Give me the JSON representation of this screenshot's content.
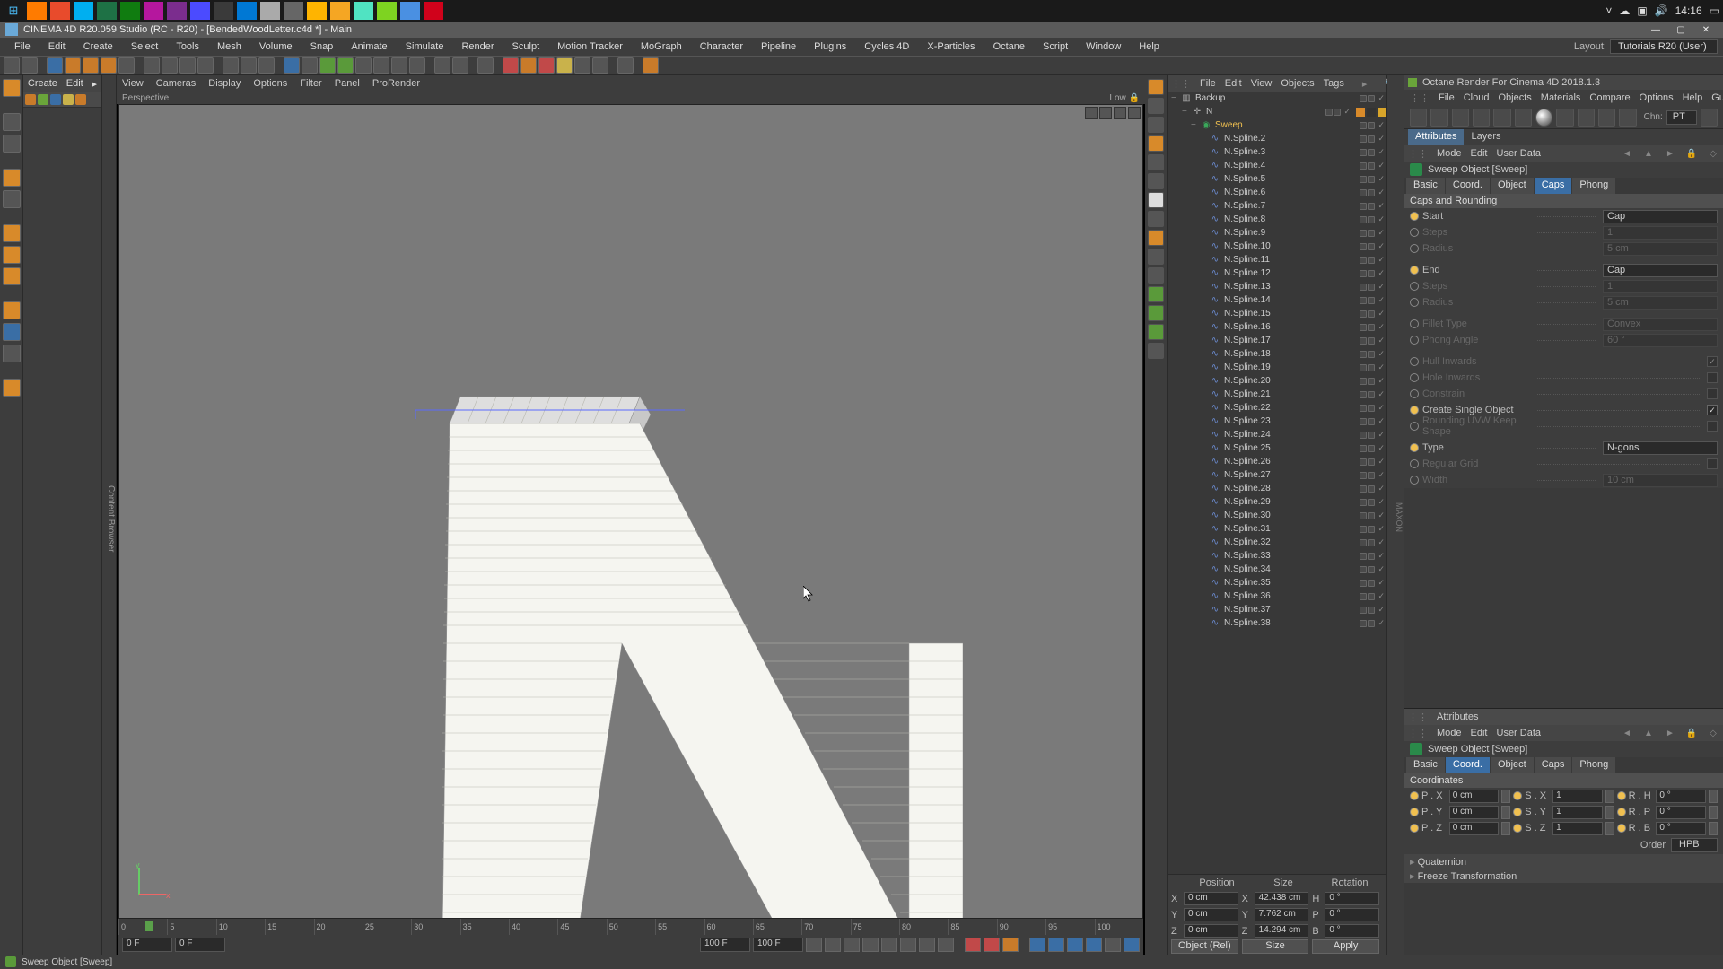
{
  "taskbar": {
    "time": "14:16",
    "icons": [
      "win",
      "ff",
      "ch",
      "sk",
      "xb",
      "a",
      "b",
      "c",
      "d",
      "e",
      "f",
      "g",
      "h",
      "j",
      "k",
      "l",
      "m",
      "n",
      "o"
    ],
    "tray": [
      "▲",
      "☁",
      "▣",
      "🔊"
    ]
  },
  "titlebar": {
    "title": "CINEMA 4D R20.059 Studio (RC - R20) - [BendedWoodLetter.c4d *] - Main"
  },
  "mainmenu": {
    "items": [
      "File",
      "Edit",
      "Create",
      "Select",
      "Tools",
      "Mesh",
      "Volume",
      "Snap",
      "Animate",
      "Simulate",
      "Render",
      "Sculpt",
      "Motion Tracker",
      "MoGraph",
      "Character",
      "Pipeline",
      "Plugins",
      "Cycles 4D",
      "X-Particles",
      "Octane",
      "Script",
      "Window",
      "Help"
    ],
    "layout_label": "Layout:",
    "layout_value": "Tutorials R20 (User)"
  },
  "palette": {
    "create": "Create",
    "edit": "Edit"
  },
  "content_browser_tab": "Content Browser",
  "viewport": {
    "menu": [
      "View",
      "Cameras",
      "Display",
      "Options",
      "Filter",
      "Panel",
      "ProRender"
    ],
    "label_left": "Perspective",
    "label_right": "Low"
  },
  "timeline": {
    "marks": [
      "0",
      "5",
      "10",
      "15",
      "20",
      "25",
      "30",
      "35",
      "40",
      "45",
      "50",
      "55",
      "60",
      "65",
      "70",
      "75",
      "80",
      "85",
      "90",
      "95",
      "100"
    ],
    "frame_start": "0 F",
    "frame_cur": "0 F",
    "frame_end1": "100 F",
    "frame_end2": "100 F"
  },
  "hierarchy": {
    "menu": [
      "File",
      "Edit",
      "View",
      "Objects",
      "Tags"
    ],
    "rows": [
      {
        "icon": "layer",
        "label": "Backup",
        "indent": 0,
        "toggle": "−"
      },
      {
        "icon": "axis",
        "label": "N",
        "indent": 1,
        "toggle": "−",
        "tags": true
      },
      {
        "icon": "sweep",
        "label": "Sweep",
        "indent": 2,
        "toggle": "−",
        "sel": true
      },
      {
        "icon": "spline",
        "label": "N.Spline.2",
        "indent": 3
      },
      {
        "icon": "spline",
        "label": "N.Spline.3",
        "indent": 3
      },
      {
        "icon": "spline",
        "label": "N.Spline.4",
        "indent": 3
      },
      {
        "icon": "spline",
        "label": "N.Spline.5",
        "indent": 3
      },
      {
        "icon": "spline",
        "label": "N.Spline.6",
        "indent": 3
      },
      {
        "icon": "spline",
        "label": "N.Spline.7",
        "indent": 3
      },
      {
        "icon": "spline",
        "label": "N.Spline.8",
        "indent": 3
      },
      {
        "icon": "spline",
        "label": "N.Spline.9",
        "indent": 3
      },
      {
        "icon": "spline",
        "label": "N.Spline.10",
        "indent": 3
      },
      {
        "icon": "spline",
        "label": "N.Spline.11",
        "indent": 3
      },
      {
        "icon": "spline",
        "label": "N.Spline.12",
        "indent": 3
      },
      {
        "icon": "spline",
        "label": "N.Spline.13",
        "indent": 3
      },
      {
        "icon": "spline",
        "label": "N.Spline.14",
        "indent": 3
      },
      {
        "icon": "spline",
        "label": "N.Spline.15",
        "indent": 3
      },
      {
        "icon": "spline",
        "label": "N.Spline.16",
        "indent": 3
      },
      {
        "icon": "spline",
        "label": "N.Spline.17",
        "indent": 3
      },
      {
        "icon": "spline",
        "label": "N.Spline.18",
        "indent": 3
      },
      {
        "icon": "spline",
        "label": "N.Spline.19",
        "indent": 3
      },
      {
        "icon": "spline",
        "label": "N.Spline.20",
        "indent": 3
      },
      {
        "icon": "spline",
        "label": "N.Spline.21",
        "indent": 3
      },
      {
        "icon": "spline",
        "label": "N.Spline.22",
        "indent": 3
      },
      {
        "icon": "spline",
        "label": "N.Spline.23",
        "indent": 3
      },
      {
        "icon": "spline",
        "label": "N.Spline.24",
        "indent": 3
      },
      {
        "icon": "spline",
        "label": "N.Spline.25",
        "indent": 3
      },
      {
        "icon": "spline",
        "label": "N.Spline.26",
        "indent": 3
      },
      {
        "icon": "spline",
        "label": "N.Spline.27",
        "indent": 3
      },
      {
        "icon": "spline",
        "label": "N.Spline.28",
        "indent": 3
      },
      {
        "icon": "spline",
        "label": "N.Spline.29",
        "indent": 3
      },
      {
        "icon": "spline",
        "label": "N.Spline.30",
        "indent": 3
      },
      {
        "icon": "spline",
        "label": "N.Spline.31",
        "indent": 3
      },
      {
        "icon": "spline",
        "label": "N.Spline.32",
        "indent": 3
      },
      {
        "icon": "spline",
        "label": "N.Spline.33",
        "indent": 3
      },
      {
        "icon": "spline",
        "label": "N.Spline.34",
        "indent": 3
      },
      {
        "icon": "spline",
        "label": "N.Spline.35",
        "indent": 3
      },
      {
        "icon": "spline",
        "label": "N.Spline.36",
        "indent": 3
      },
      {
        "icon": "spline",
        "label": "N.Spline.37",
        "indent": 3
      },
      {
        "icon": "spline",
        "label": "N.Spline.38",
        "indent": 3
      }
    ]
  },
  "coords": {
    "heads": [
      "Position",
      "Size",
      "Rotation"
    ],
    "rows": [
      {
        "axis": "X",
        "pos": "0 cm",
        "size": "42.438 cm",
        "rot": "0 °"
      },
      {
        "axis": "Y",
        "pos": "0 cm",
        "size": "7.762 cm",
        "rot": "0 °"
      },
      {
        "axis": "Z",
        "pos": "0 cm",
        "size": "14.294 cm",
        "rot": "0 °"
      }
    ],
    "mode1": "Object (Rel)",
    "mode2": "Size",
    "apply": "Apply"
  },
  "octane": {
    "title": "Octane Render For Cinema 4D 2018.1.3",
    "menu": [
      "File",
      "Cloud",
      "Objects",
      "Materials",
      "Compare",
      "Options",
      "Help",
      "Gui"
    ],
    "chn_label": "Chn:",
    "chn_value": "PT"
  },
  "attr1": {
    "tabs": [
      "Attributes",
      "Layers"
    ],
    "sub": [
      "Mode",
      "Edit",
      "User Data"
    ],
    "obj": "Sweep Object [Sweep]",
    "tabs2": [
      "Basic",
      "Coord.",
      "Object",
      "Caps",
      "Phong"
    ],
    "tabs2_active": 3,
    "section": "Caps and Rounding",
    "params": [
      {
        "ring": true,
        "label": "Start",
        "value": "Cap",
        "type": "dd"
      },
      {
        "ring": false,
        "label": "Steps",
        "value": "1",
        "type": "num",
        "dim": true
      },
      {
        "ring": false,
        "label": "Radius",
        "value": "5 cm",
        "type": "num",
        "dim": true
      },
      {
        "ring": true,
        "label": "End",
        "value": "Cap",
        "type": "dd"
      },
      {
        "ring": false,
        "label": "Steps",
        "value": "1",
        "type": "num",
        "dim": true
      },
      {
        "ring": false,
        "label": "Radius",
        "value": "5 cm",
        "type": "num",
        "dim": true
      },
      {
        "ring": false,
        "label": "Fillet Type",
        "value": "Convex",
        "type": "dd",
        "dim": true
      },
      {
        "ring": false,
        "label": "Phong Angle",
        "value": "60 °",
        "type": "num",
        "dim": true
      },
      {
        "ring": false,
        "label": "Hull Inwards",
        "type": "chk",
        "checked": true,
        "dim": true
      },
      {
        "ring": false,
        "label": "Hole Inwards",
        "type": "chk",
        "checked": false,
        "dim": true
      },
      {
        "ring": false,
        "label": "Constrain",
        "type": "chk",
        "checked": false,
        "dim": true
      },
      {
        "ring": true,
        "label": "Create Single Object",
        "type": "chk",
        "checked": true
      },
      {
        "ring": false,
        "label": "Rounding UVW Keep Shape",
        "type": "chk",
        "checked": false,
        "dim": true
      },
      {
        "ring": true,
        "label": "Type",
        "value": "N-gons",
        "type": "dd"
      },
      {
        "ring": false,
        "label": "Regular Grid",
        "type": "chk",
        "checked": false,
        "dim": true
      },
      {
        "ring": false,
        "label": "Width",
        "value": "10 cm",
        "type": "num",
        "dim": true
      }
    ]
  },
  "attr2": {
    "head": "Attributes",
    "sub": [
      "Mode",
      "Edit",
      "User Data"
    ],
    "obj": "Sweep Object [Sweep]",
    "tabs2": [
      "Basic",
      "Coord.",
      "Object",
      "Caps",
      "Phong"
    ],
    "tabs2_active": 1,
    "section": "Coordinates",
    "xyz": [
      {
        "p": "P . X",
        "pv": "0 cm",
        "s": "S . X",
        "sv": "1",
        "r": "R . H",
        "rv": "0 °"
      },
      {
        "p": "P . Y",
        "pv": "0 cm",
        "s": "S . Y",
        "sv": "1",
        "r": "R . P",
        "rv": "0 °"
      },
      {
        "p": "P . Z",
        "pv": "0 cm",
        "s": "S . Z",
        "sv": "1",
        "r": "R . B",
        "rv": "0 °"
      }
    ],
    "order_label": "Order",
    "order_value": "HPB",
    "acc1": "Quaternion",
    "acc2": "Freeze Transformation"
  },
  "status": "Sweep Object [Sweep]",
  "maxon_tab": "MAXON"
}
